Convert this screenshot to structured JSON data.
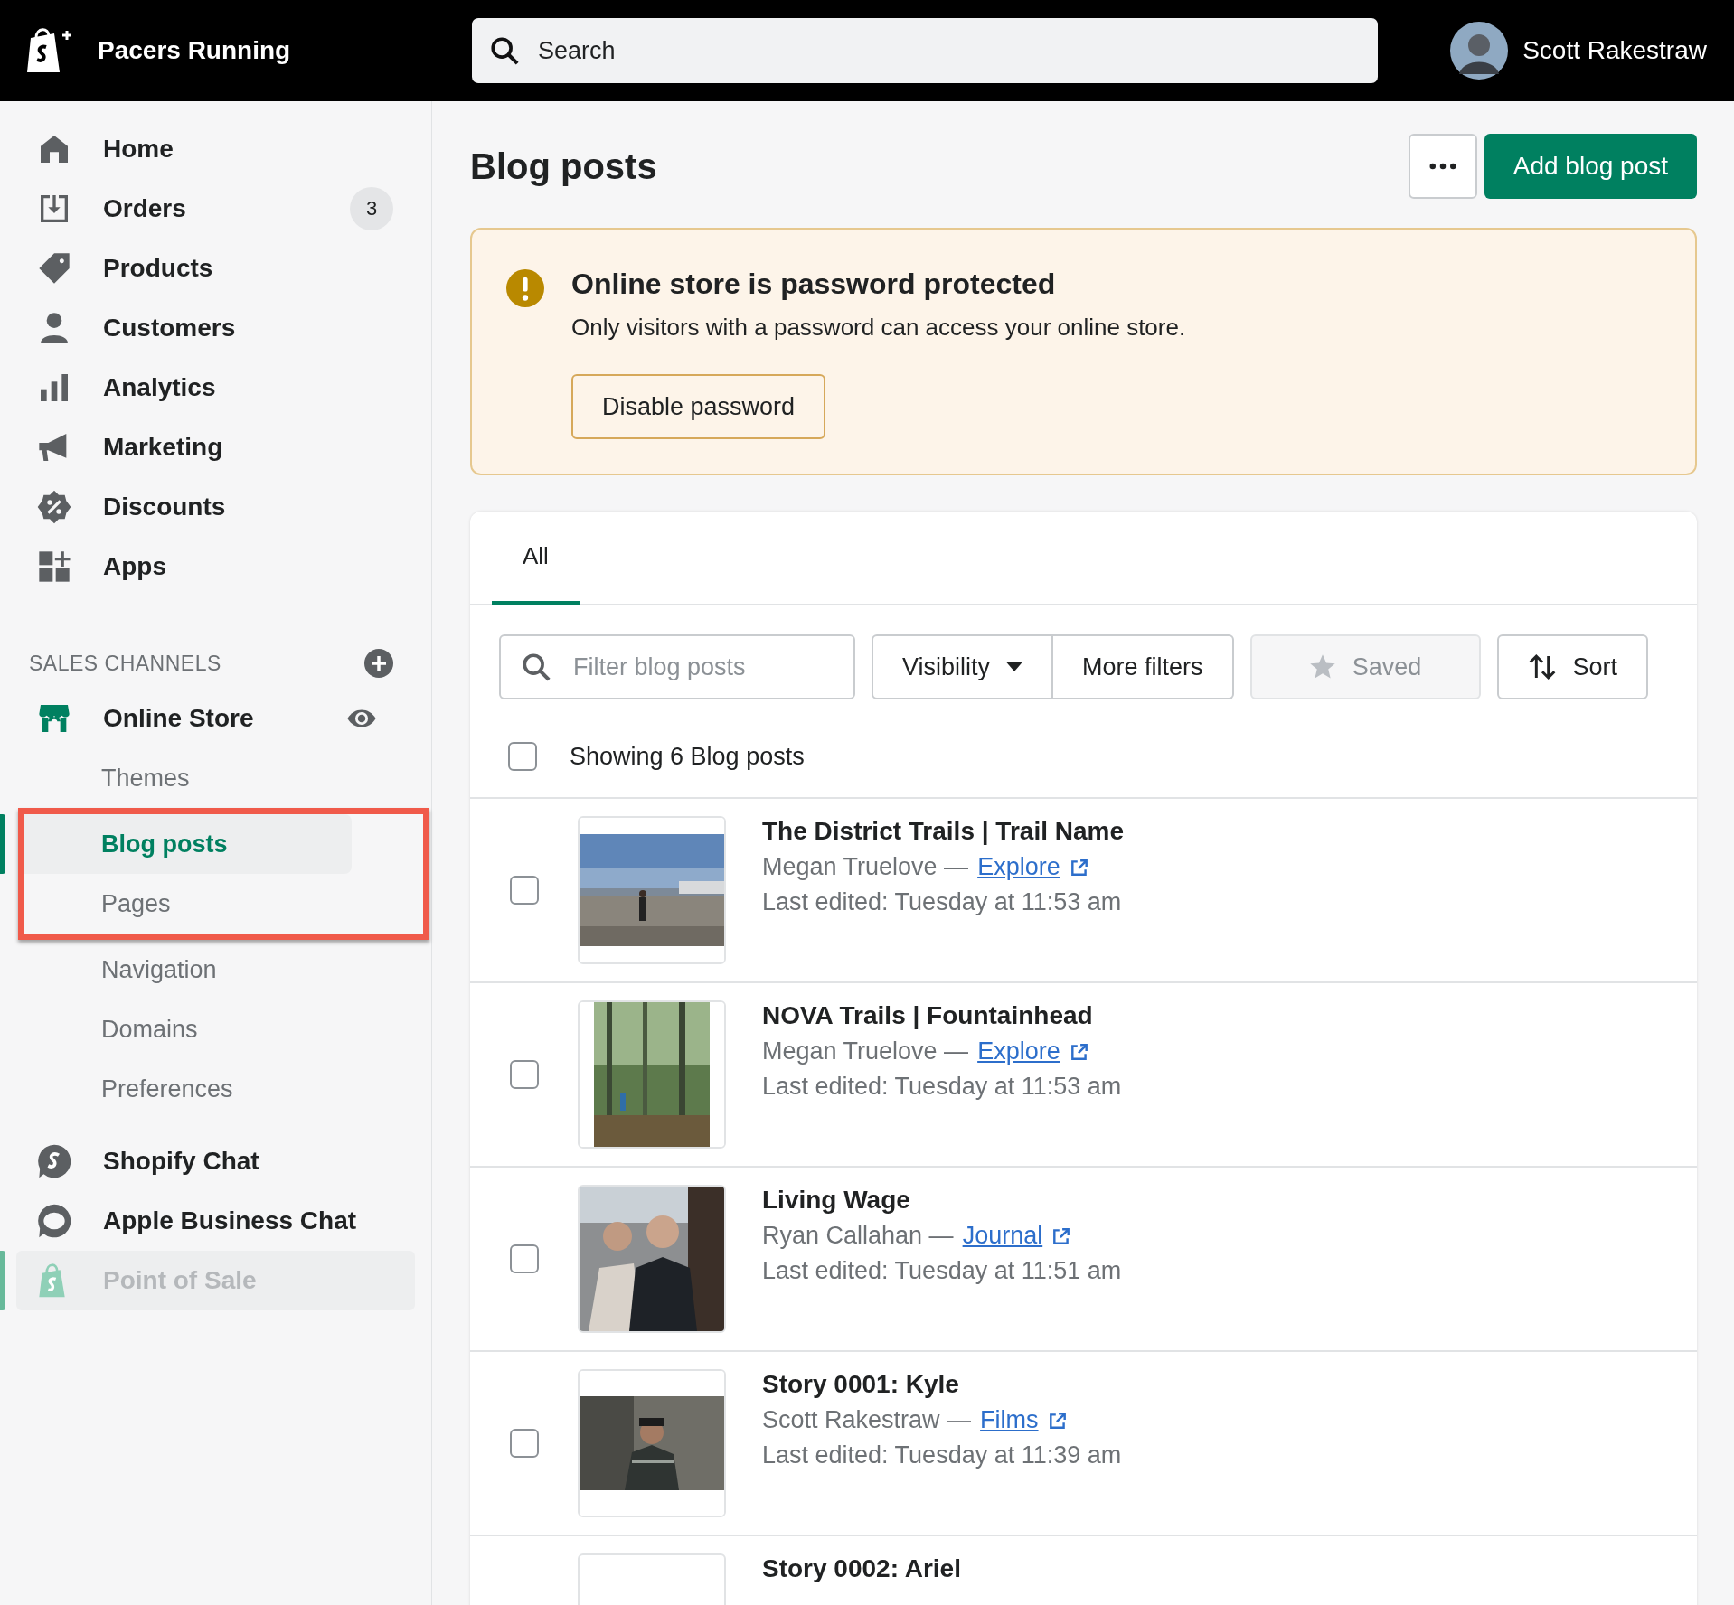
{
  "topbar": {
    "store_name": "Pacers Running",
    "search": {
      "placeholder": "Search"
    },
    "user_name": "Scott Rakestraw"
  },
  "sidebar": {
    "items": [
      {
        "label": "Home"
      },
      {
        "label": "Orders",
        "badge": "3"
      },
      {
        "label": "Products"
      },
      {
        "label": "Customers"
      },
      {
        "label": "Analytics"
      },
      {
        "label": "Marketing"
      },
      {
        "label": "Discounts"
      },
      {
        "label": "Apps"
      }
    ],
    "section_title": "SALES CHANNELS",
    "channel": {
      "label": "Online Store",
      "sub_items": [
        {
          "label": "Themes",
          "selected": false,
          "highlighted": false
        },
        {
          "label": "Blog posts",
          "selected": true,
          "highlighted": true
        },
        {
          "label": "Pages",
          "selected": false,
          "highlighted": true
        },
        {
          "label": "Navigation",
          "selected": false,
          "highlighted": false
        },
        {
          "label": "Domains",
          "selected": false,
          "highlighted": false
        },
        {
          "label": "Preferences",
          "selected": false,
          "highlighted": false
        }
      ]
    },
    "apps": [
      {
        "label": "Shopify Chat",
        "disabled": false
      },
      {
        "label": "Apple Business Chat",
        "disabled": false
      },
      {
        "label": "Point of Sale",
        "disabled": true
      }
    ]
  },
  "page": {
    "title": "Blog posts",
    "primary_action": "Add blog post"
  },
  "banner": {
    "title": "Online store is password protected",
    "text": "Only visitors with a password can access your online store.",
    "action": "Disable password"
  },
  "tabs": [
    {
      "label": "All",
      "selected": true
    }
  ],
  "filters": {
    "placeholder": "Filter blog posts",
    "visibility": "Visibility",
    "more": "More filters",
    "saved": "Saved",
    "saved_disabled": true,
    "sort": "Sort"
  },
  "list_header": {
    "text": "Showing 6 Blog posts",
    "checked": false
  },
  "posts": [
    {
      "title": "The District Trails | Trail Name",
      "author": "Megan Truelove —",
      "blog": "Explore",
      "edited": "Last edited: Tuesday at 11:53 am",
      "checked": false,
      "kind": "picture"
    },
    {
      "title": "NOVA Trails | Fountainhead",
      "author": "Megan Truelove —",
      "blog": "Explore",
      "edited": "Last edited: Tuesday at 11:53 am",
      "checked": false,
      "kind": "picture"
    },
    {
      "title": "Living Wage",
      "author": "Ryan Callahan —",
      "blog": "Journal",
      "edited": "Last edited: Tuesday at 11:51 am",
      "checked": false,
      "kind": "picture"
    },
    {
      "title": "Story 0001: Kyle",
      "author": "Scott Rakestraw —",
      "blog": "Films",
      "edited": "Last edited: Tuesday at 11:39 am",
      "checked": false,
      "kind": "picture"
    },
    {
      "title": "Story 0002: Ariel"
    }
  ]
}
